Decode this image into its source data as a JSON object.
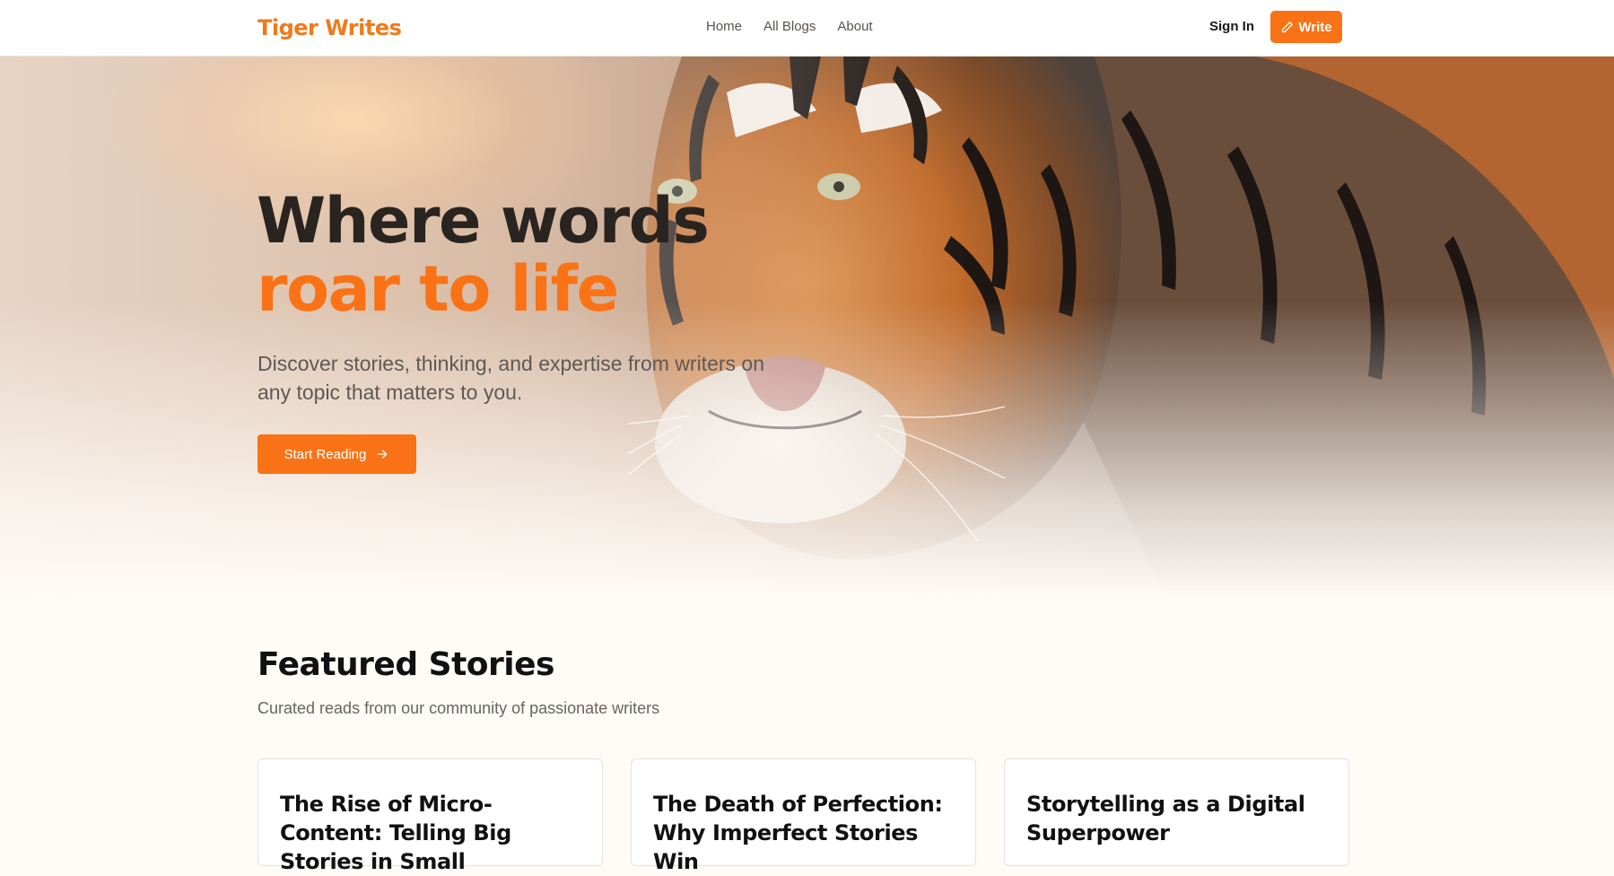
{
  "nav": {
    "brand": "Tiger Writes",
    "links": [
      "Home",
      "All Blogs",
      "About"
    ],
    "sign_in": "Sign In",
    "write": "Write",
    "write_icon": "pencil-icon"
  },
  "hero": {
    "title_line1": "Where words",
    "title_line2": "roar to life",
    "subtitle": "Discover stories, thinking, and expertise from writers on any topic that matters to you.",
    "cta": "Start Reading",
    "cta_icon": "arrow-right-icon",
    "image": "tiger-photo"
  },
  "featured": {
    "title": "Featured Stories",
    "subtitle": "Curated reads from our community of passionate writers",
    "cards": [
      {
        "title": "The Rise of Micro-Content: Telling Big Stories in Small"
      },
      {
        "title": "The Death of Perfection: Why Imperfect Stories Win"
      },
      {
        "title": "Storytelling as a Digital Superpower"
      }
    ]
  },
  "colors": {
    "accent": "#f97316",
    "brand": "#f07a1a",
    "heading": "#2a2420",
    "background": "#fffbf7"
  }
}
